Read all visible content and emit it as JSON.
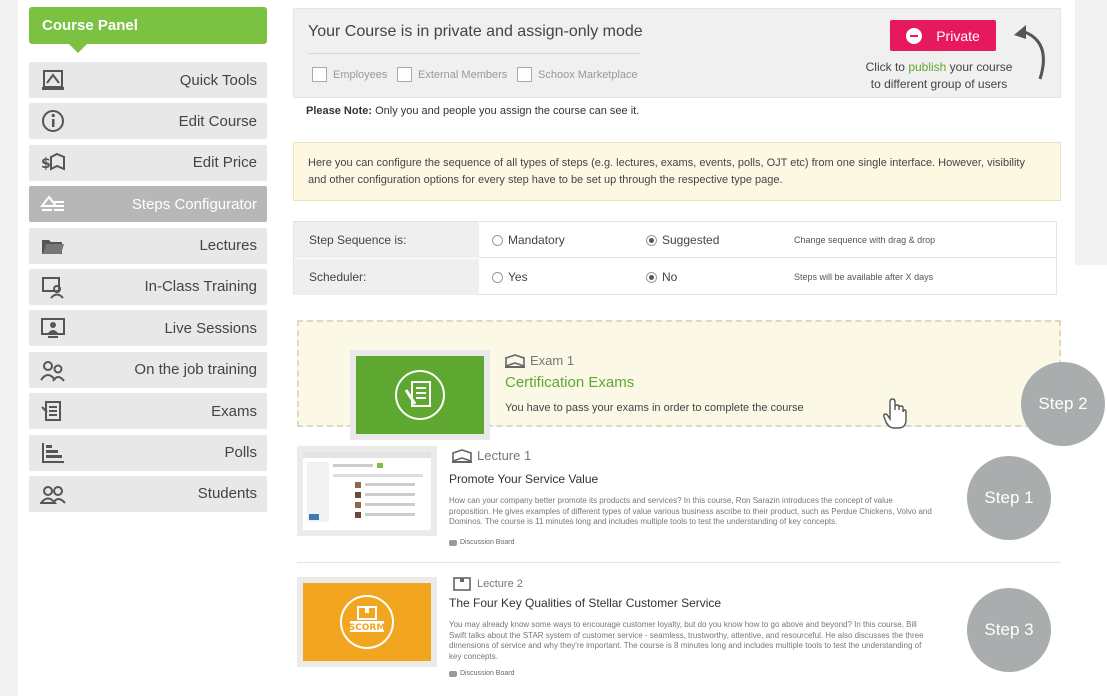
{
  "sidebar": {
    "title": "Course Panel",
    "items": [
      {
        "label": "Quick Tools",
        "icon": "book-icon",
        "active": false
      },
      {
        "label": "Edit Course",
        "icon": "info-icon",
        "active": false
      },
      {
        "label": "Edit Price",
        "icon": "price-book-icon",
        "active": false
      },
      {
        "label": "Steps Configurator",
        "icon": "steps-icon",
        "active": true
      },
      {
        "label": "Lectures",
        "icon": "folder-icon",
        "active": false
      },
      {
        "label": "In-Class Training",
        "icon": "classroom-icon",
        "active": false
      },
      {
        "label": "Live Sessions",
        "icon": "monitor-person-icon",
        "active": false
      },
      {
        "label": "On the job training",
        "icon": "trainer-icon",
        "active": false
      },
      {
        "label": "Exams",
        "icon": "exam-icon",
        "active": false
      },
      {
        "label": "Polls",
        "icon": "poll-icon",
        "active": false
      },
      {
        "label": "Students",
        "icon": "students-icon",
        "active": false
      }
    ]
  },
  "privacy": {
    "title": "Your Course is in private and assign-only mode",
    "checkboxes": [
      "Employees",
      "External Members",
      "Schoox Marketplace"
    ],
    "button_label": "Private",
    "publish_pre": "Click to ",
    "publish_link": "publish",
    "publish_post": " your course",
    "publish_line2": "to different group of users"
  },
  "note": {
    "label": "Please Note:",
    "text": " Only you and people you assign the course can see it."
  },
  "info": "Here you can configure the sequence of all types of steps (e.g. lectures, exams, events, polls, OJT etc) from one single interface. However, visibility and other configuration options for every step have to be set up through the respective type page.",
  "settings": {
    "sequence": {
      "label": "Step Sequence is:",
      "opt1": "Mandatory",
      "opt2": "Suggested",
      "hint": "Change sequence with drag & drop"
    },
    "scheduler": {
      "label": "Scheduler:",
      "opt1": "Yes",
      "opt2": "No",
      "hint": "Steps will be available after X days"
    }
  },
  "steps": {
    "exam": {
      "caption": "Exam 1",
      "title": "Certification Exams",
      "desc": "You have to pass your exams in order to complete the course",
      "badge": "Step 2"
    },
    "lecture1": {
      "caption": "Lecture 1",
      "title": "Promote Your Service Value",
      "desc": "How can your company better promote its products and services? In this course, Ron Sarazin introduces the concept of value proposition. He gives examples of different types of value various business ascribe to their product, such as Perdue Chickens, Volvo and Dominos. The course is 11 minutes long and includes multiple tools to test the understanding of key concepts.",
      "meta": "Discussion Board",
      "badge": "Step 1"
    },
    "lecture2": {
      "caption": "Lecture 2",
      "title": "The Four Key Qualities of Stellar Customer Service",
      "desc": "You may already know some ways to encourage customer loyalty, but do you know how to go above and beyond? In this course, Bill Swift talks about the STAR system of customer service - seamless, trustworthy, attentive, and resourceful. He also discusses the three dimensions of service and why they're important. The course is 8 minutes long and includes multiple tools to test the understanding of key concepts.",
      "meta": "Discussion Board",
      "badge": "Step 3",
      "thumb_label": "SCORM"
    }
  },
  "colors": {
    "accent_green": "#7bc142",
    "private_pink": "#e6195d",
    "step_grey": "#a9adad",
    "exam_green": "#5ea832",
    "scorm_orange": "#f2a51e"
  }
}
